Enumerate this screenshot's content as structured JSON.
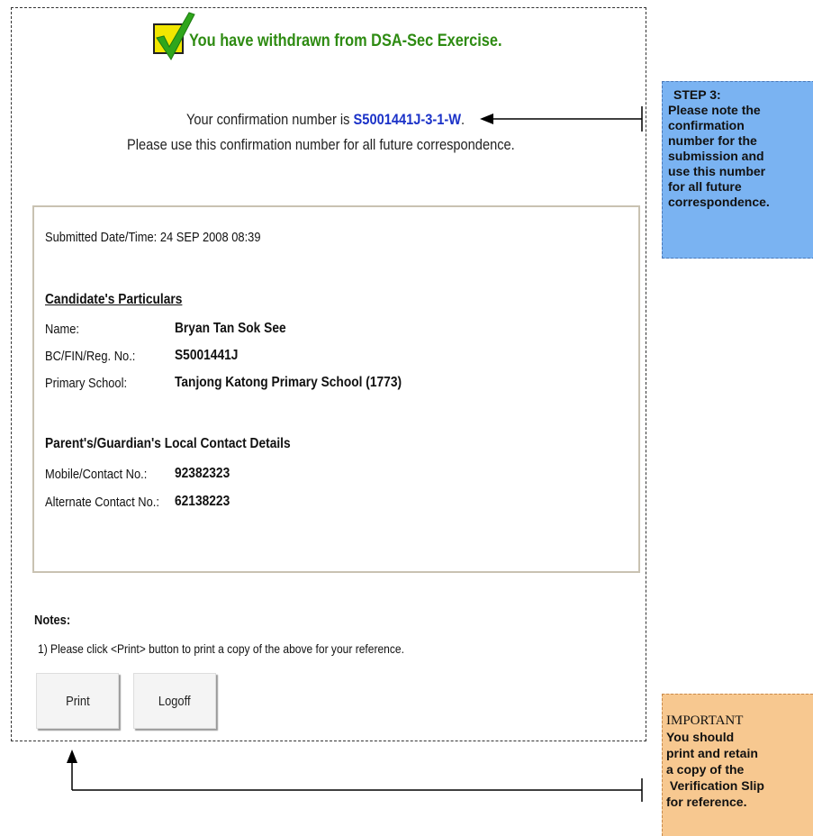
{
  "header": {
    "message": "You have withdrawn from DSA-Sec Exercise."
  },
  "confirmation": {
    "prefix": "Your confirmation number is ",
    "number": "S5001441J-3-1-W",
    "suffix": ".",
    "instruction": "Please use this confirmation number for all future correspondence."
  },
  "details": {
    "submitted": "Submitted Date/Time: 24 SEP 2008 08:39",
    "candidate_heading": "Candidate's Particulars",
    "name_label": "Name:",
    "name_value": "Bryan Tan Sok See",
    "id_label": "BC/FIN/Reg. No.:",
    "id_value": "S5001441J",
    "school_label": "Primary School:",
    "school_value": "Tanjong Katong Primary School (1773)",
    "contact_heading": "Parent's/Guardian's Local Contact Details",
    "mobile_label": "Mobile/Contact No.:",
    "mobile_value": "92382323",
    "alt_label": "Alternate Contact No.:",
    "alt_value": "62138223"
  },
  "notes": {
    "title": "Notes:",
    "note1": "1) Please click <Print> button to print a copy of the above for your reference."
  },
  "buttons": {
    "print": "Print",
    "logoff": "Logoff"
  },
  "callouts": {
    "step_title": "STEP 3:",
    "step_lines": [
      "Please note the",
      "confirmation",
      "number for the",
      "submission and",
      "use this number",
      "for all future",
      "correspondence."
    ],
    "important_title": "IMPORTANT",
    "important_lines": [
      "You should",
      "print and retain",
      "a copy of the",
      " Verification Slip",
      "for reference."
    ]
  },
  "colors": {
    "headline": "#2e8b12",
    "confirmation_number": "#1b32c8",
    "step_callout": "#7ab3f2",
    "important_callout": "#f7c890"
  }
}
